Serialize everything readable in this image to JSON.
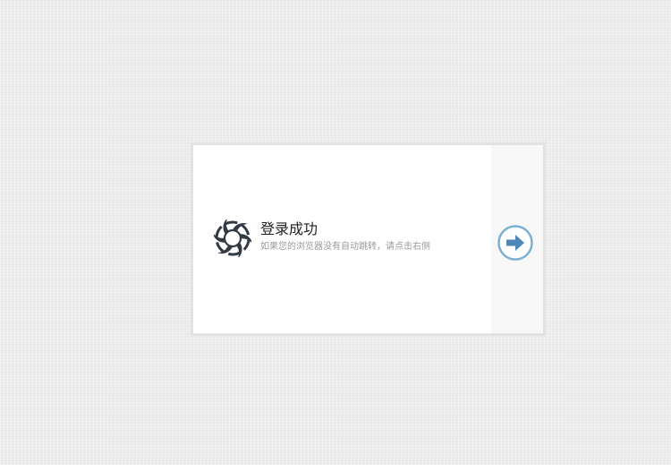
{
  "status": {
    "title": "登录成功",
    "message": "如果您的浏览器没有自动跳转，请点击右侧"
  },
  "icons": {
    "logo": "swirl-logo-icon",
    "next": "arrow-right-circle-icon"
  },
  "colors": {
    "background": "#efefef",
    "card_border": "#e2e2e2",
    "logo": "#333a45",
    "next_ring": "#7fb0d2",
    "next_arrow": "#4f87b8"
  }
}
